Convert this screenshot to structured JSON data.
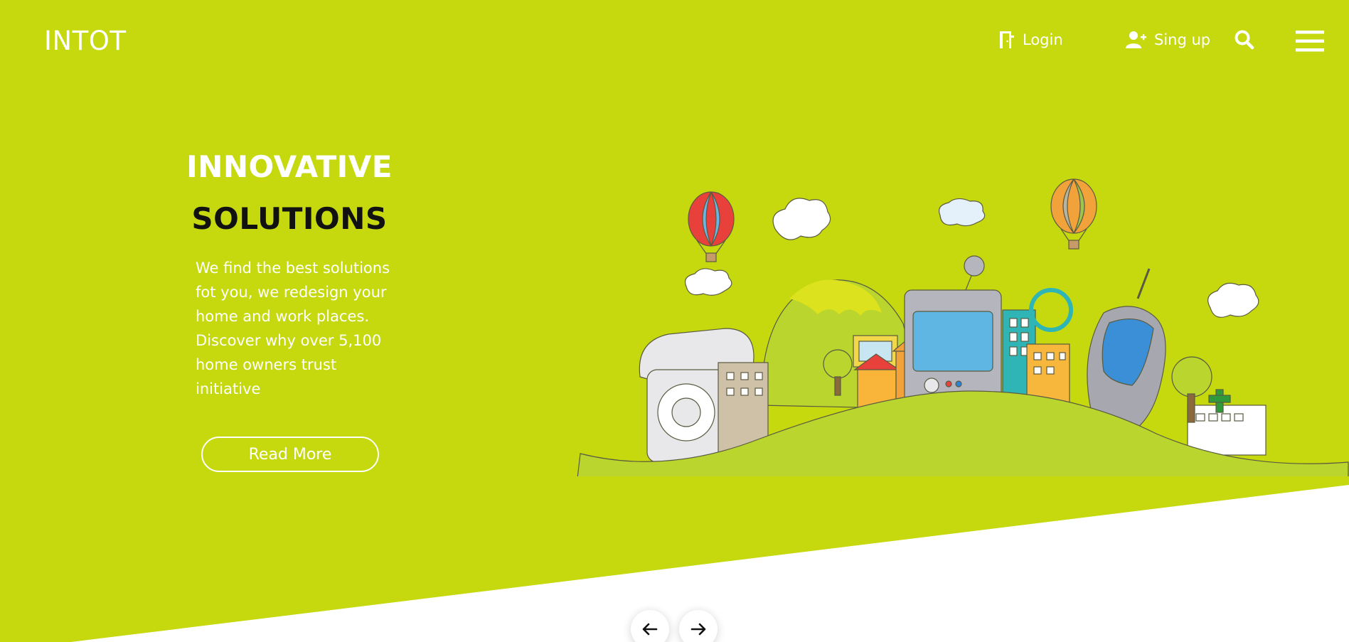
{
  "brand": {
    "logo": "INTOT"
  },
  "nav": {
    "login_label": "Login",
    "signup_label": "Sing up",
    "login_icon": "door-icon",
    "signup_icon": "user-plus-icon",
    "search_icon": "search-icon",
    "menu_icon": "hamburger-menu-icon"
  },
  "hero": {
    "title_line1": "INNOVATIVE",
    "title_line2": "SOLUTIONS",
    "description": "We find the best solutions fot you, we redesign your home and work places. Discover why over 5,100 home owners trust initiative",
    "cta_label": "Read More",
    "illustration": "cartoon-city-illustration"
  },
  "carousel": {
    "prev_icon": "arrow-left-icon",
    "next_icon": "arrow-right-icon"
  },
  "colors": {
    "accent": "#c5d90e",
    "text_light": "#ffffff",
    "text_dark": "#111111"
  }
}
